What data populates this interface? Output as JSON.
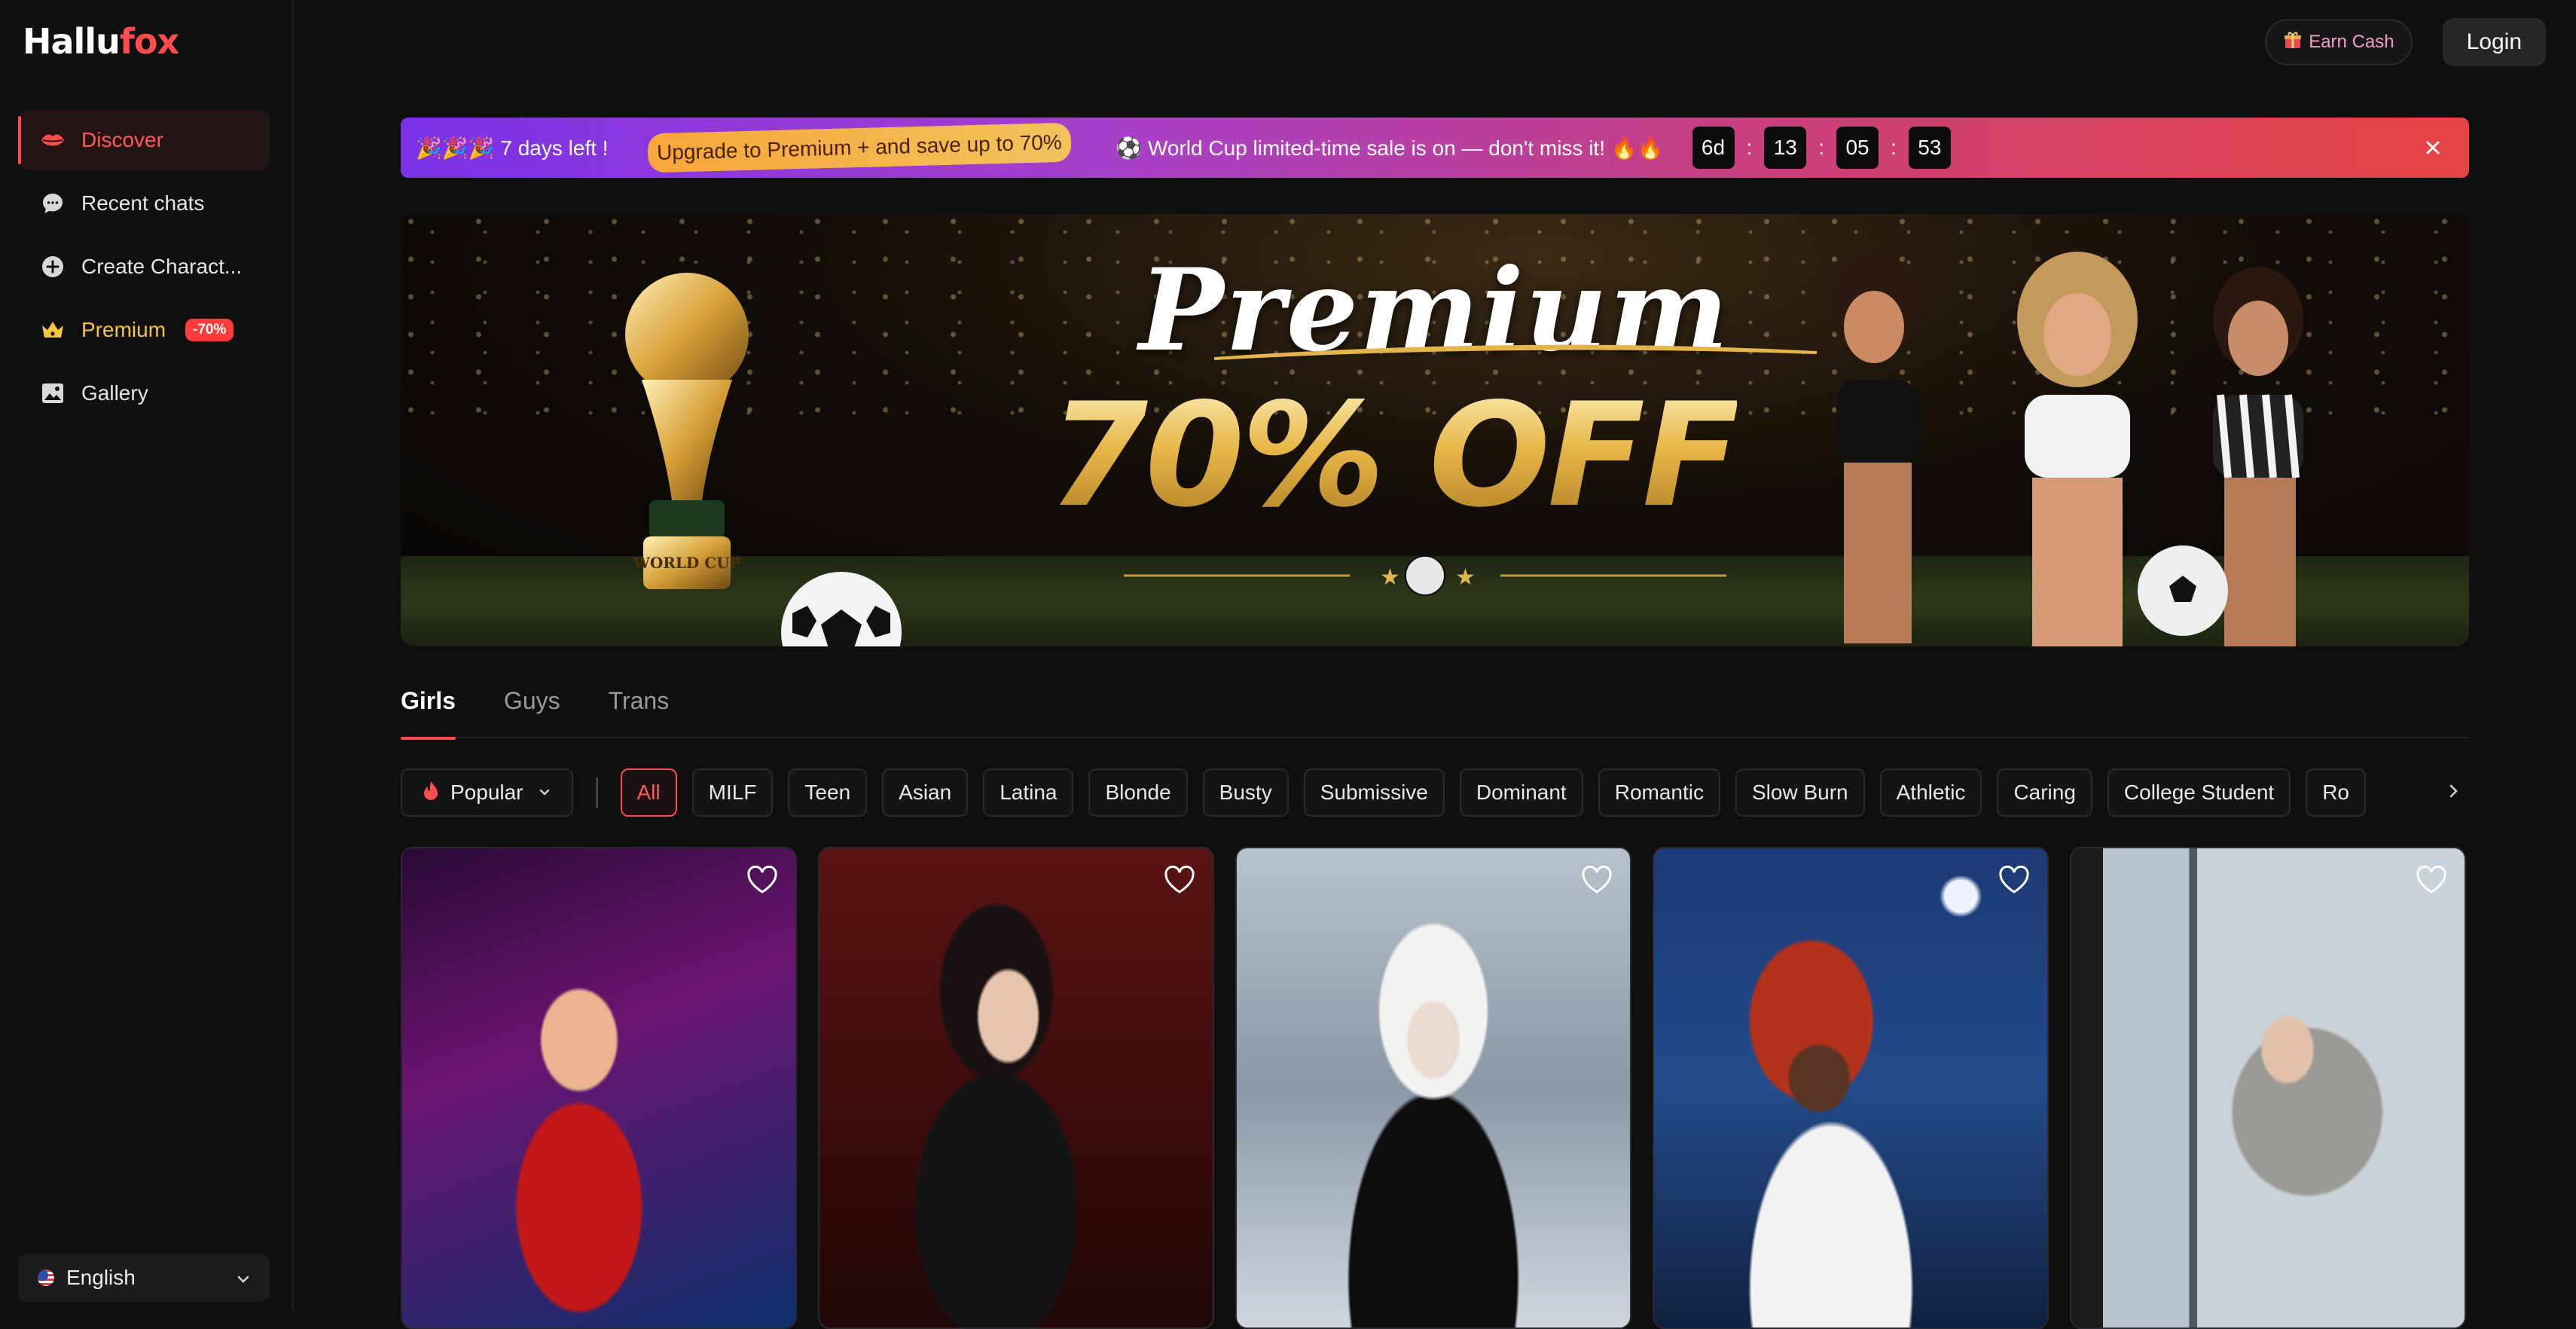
{
  "brand": {
    "part1": "Hallu",
    "part2": "fox"
  },
  "sidebar": {
    "items": [
      {
        "label": "Discover",
        "icon": "lips-icon"
      },
      {
        "label": "Recent chats",
        "icon": "chat-bubble-icon"
      },
      {
        "label": "Create Charact...",
        "icon": "plus-circle-icon"
      },
      {
        "label": "Premium",
        "icon": "crown-icon",
        "badge": "-70%"
      },
      {
        "label": "Gallery",
        "icon": "image-icon"
      }
    ],
    "language": "English"
  },
  "header": {
    "earn_cash": "Earn Cash",
    "login": "Login"
  },
  "promo": {
    "days_left": "🎉🎉🎉 7 days left !",
    "upgrade": "Upgrade to Premium + and save up to 70%",
    "message": "⚽ World Cup limited-time sale is on — don't miss it! 🔥🔥",
    "timer": {
      "d": "6d",
      "h": "13",
      "m": "05",
      "s": "53"
    }
  },
  "hero": {
    "line1": "Premium",
    "line2": "70% OFF",
    "trophy_text": "WORLD CUP"
  },
  "tabs": [
    "Girls",
    "Guys",
    "Trans"
  ],
  "filters": {
    "sort": "Popular",
    "chips": [
      "All",
      "MILF",
      "Teen",
      "Asian",
      "Latina",
      "Blonde",
      "Busty",
      "Submissive",
      "Dominant",
      "Romantic",
      "Slow Burn",
      "Athletic",
      "Caring",
      "College Student",
      "Ro"
    ]
  },
  "colors": {
    "accent": "#ff4d4f",
    "premium": "#f5c542"
  }
}
